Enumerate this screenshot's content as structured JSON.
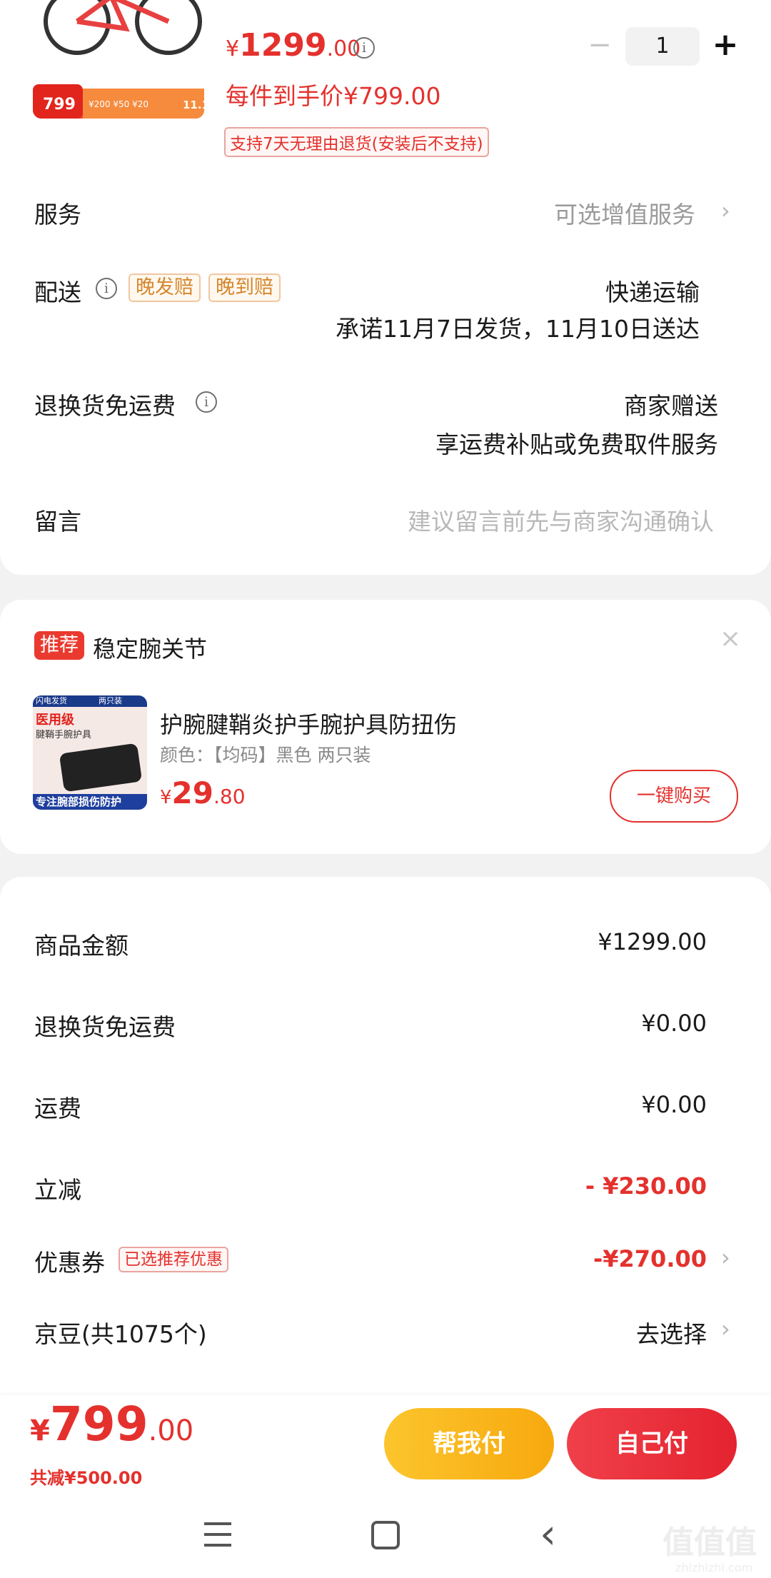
{
  "product": {
    "price_int": "1299",
    "price_dec": ".00",
    "currency": "¥",
    "per_item_price": "每件到手价¥799.00",
    "return_policy": "支持7天无理由退货(安装后不支持)",
    "quantity": "1",
    "thumb_price": "799"
  },
  "service": {
    "label": "服务",
    "value": "可选增值服务"
  },
  "delivery": {
    "label": "配送",
    "tag1": "晚发赔",
    "tag2": "晚到赔",
    "method": "快递运输",
    "schedule": "承诺11月7日发货，11月10日送达"
  },
  "return_shipping": {
    "label": "退换货免运费",
    "line1": "商家赠送",
    "line2": "享运费补贴或免费取件服务"
  },
  "message": {
    "label": "留言",
    "placeholder": "建议留言前先与商家沟通确认"
  },
  "recommend": {
    "badge": "推荐",
    "title": "稳定腕关节",
    "item_name": "护腕腱鞘炎护手腕护具防扭伤",
    "item_spec": "颜色：【均码】黑色  两只装",
    "item_price_int": "29",
    "item_price_dec": ".80",
    "buy_label": "一键购买",
    "thumb_top": "闪电发货",
    "thumb_top2": "两只装",
    "thumb_medical": "医用级",
    "thumb_sub": "腱鞘手腕护具",
    "thumb_bottom": "专注腕部损伤防护"
  },
  "summary": {
    "rows": [
      {
        "label": "商品金额",
        "value": "¥1299.00"
      },
      {
        "label": "退换货免运费",
        "value": "¥0.00"
      },
      {
        "label": "运费",
        "value": "¥0.00"
      },
      {
        "label": "立减",
        "value": "- ¥230.00"
      },
      {
        "label": "优惠券",
        "value": "-¥270.00",
        "tag": "已选推荐优惠"
      },
      {
        "label": "京豆(共1075个)",
        "value": "去选择"
      }
    ]
  },
  "footer": {
    "total_int": "799",
    "total_dec": ".00",
    "total_discount": "共减¥500.00",
    "help_pay": "帮我付",
    "self_pay": "自己付"
  },
  "watermark": "值值值",
  "watermark_url": "zhizhizhi.com",
  "colors": {
    "accent_red": "#e4312d",
    "yellow": "#f9b81a"
  }
}
